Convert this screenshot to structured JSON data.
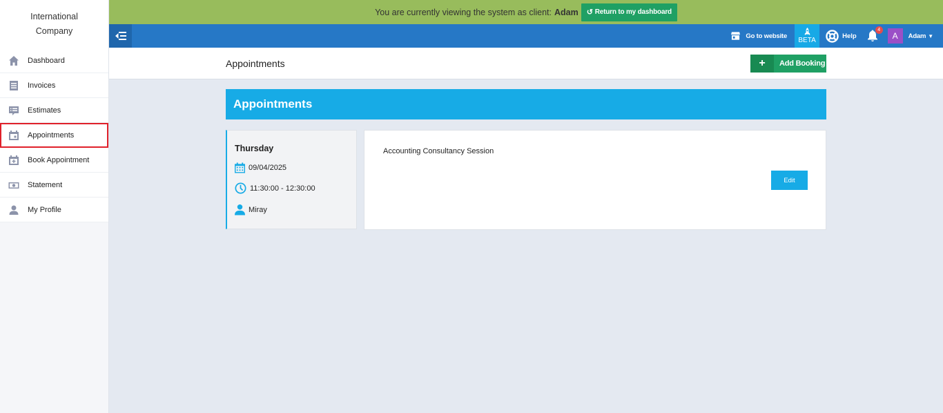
{
  "brand": {
    "line1": "International",
    "line2": "Company"
  },
  "sidebar": {
    "items": [
      {
        "label": "Dashboard",
        "icon": "home-icon"
      },
      {
        "label": "Invoices",
        "icon": "invoice-icon"
      },
      {
        "label": "Estimates",
        "icon": "estimate-icon"
      },
      {
        "label": "Appointments",
        "icon": "calendar-icon",
        "active": true
      },
      {
        "label": "Book Appointment",
        "icon": "calendar-plus-icon"
      },
      {
        "label": "Statement",
        "icon": "money-icon"
      },
      {
        "label": "My Profile",
        "icon": "user-icon"
      }
    ]
  },
  "banner": {
    "text": "You are currently viewing the system as client:",
    "client": "Adam",
    "return_label": "Return to my dashboard"
  },
  "topbar": {
    "go_website": "Go to website",
    "beta": "BETA",
    "help": "Help",
    "notifications": "4",
    "avatar_letter": "A",
    "user_name": "Adam"
  },
  "page": {
    "title": "Appointments",
    "add_booking": "Add Booking",
    "section_title": "Appointments"
  },
  "appointment": {
    "day": "Thursday",
    "date": "09/04/2025",
    "time": "11:30:00 - 12:30:00",
    "staff": "Miray",
    "service": "Accounting Consultancy Session",
    "edit_label": "Edit"
  },
  "colors": {
    "banner": "#98bc5c",
    "topbar": "#2678c6",
    "accent": "#17abe6",
    "success": "#1fa064",
    "highlight": "#e0202a"
  }
}
